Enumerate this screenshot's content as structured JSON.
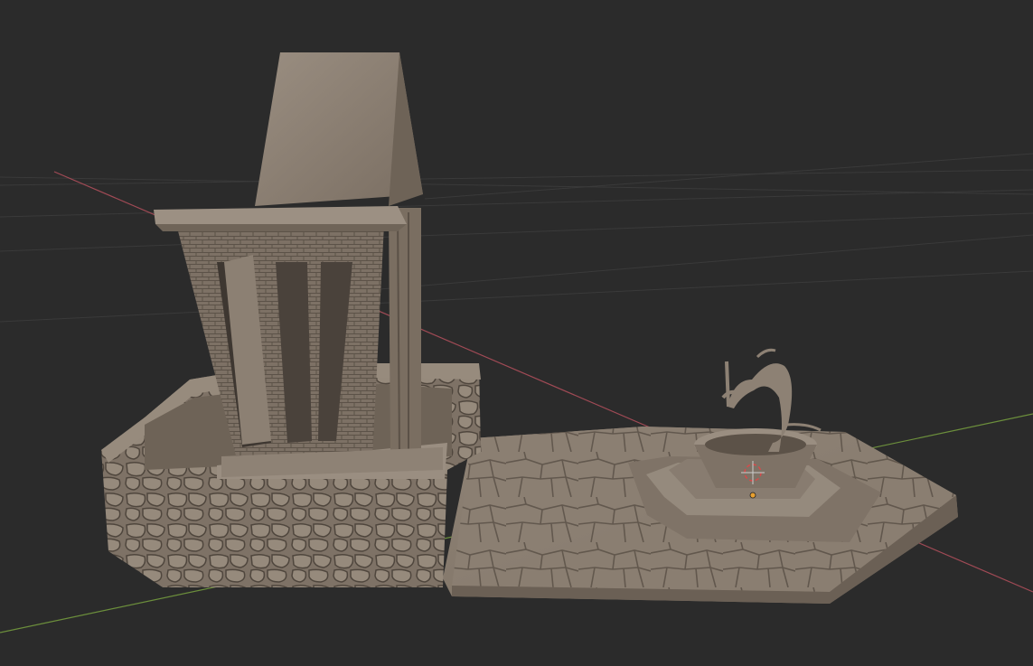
{
  "viewport": {
    "background": "#2b2b2b",
    "grid_color": "#3a3a3a",
    "x_axis_color": "#a04a55",
    "y_axis_color": "#6c8f3c",
    "clay_color": "#8a7d70",
    "cursor_icon": "3d-cursor-icon",
    "origin_icon": "object-origin-icon"
  },
  "scene": {
    "objects": [
      {
        "name": "shrine-tower",
        "icon": "mesh-object-icon"
      },
      {
        "name": "stone-wall-base",
        "icon": "mesh-object-icon"
      },
      {
        "name": "paved-floor-tile",
        "icon": "mesh-object-icon"
      },
      {
        "name": "well-with-statue",
        "icon": "mesh-object-icon"
      }
    ]
  }
}
